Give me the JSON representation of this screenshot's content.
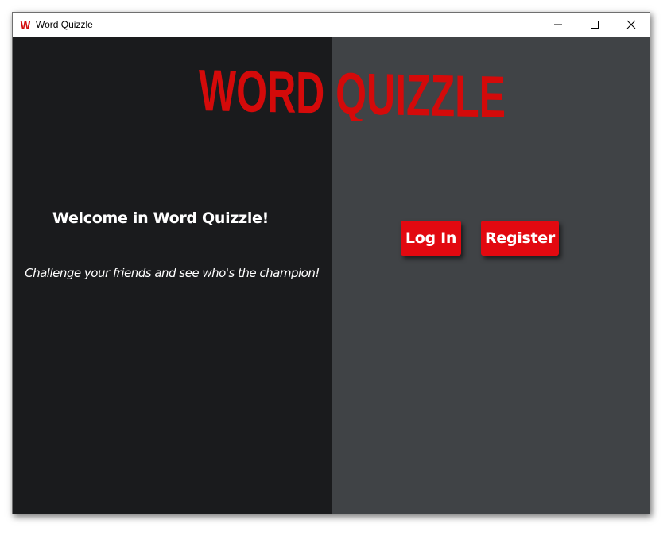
{
  "window": {
    "title": "Word Quizzle",
    "app_icon_letter": "W",
    "icon": "app-w-logo-icon",
    "controls": [
      "minimize-icon",
      "maximize-icon",
      "close-icon"
    ]
  },
  "logo": {
    "text": "WORD QUIZZLE",
    "color": "#d40a0a"
  },
  "left_panel": {
    "welcome": "Welcome in Word Quizzle!",
    "tagline": "Challenge your friends and see who's the champion!"
  },
  "actions": {
    "login_label": "Log In",
    "register_label": "Register"
  },
  "colors": {
    "left_bg": "#1a1b1d",
    "right_bg": "#404346",
    "accent": "#e20910",
    "text": "#ffffff"
  }
}
